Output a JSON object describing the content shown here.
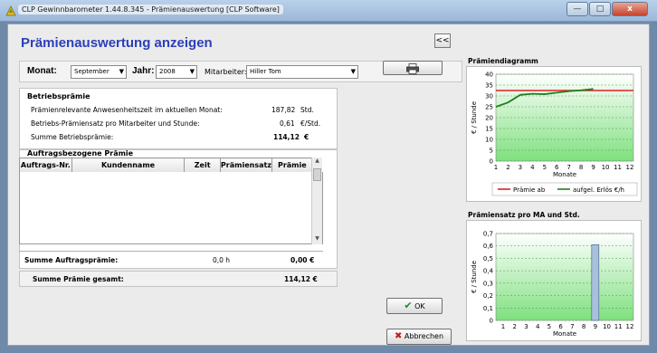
{
  "window": {
    "title": "CLP Gewinnbarometer 1.44.8.345 - Prämienauswertung  [CLP Software]",
    "min_icon": "minimize-icon",
    "max_icon": "maximize-icon",
    "close_label": "x"
  },
  "page": {
    "title": "Prämienauswertung anzeigen",
    "collapse_label": "<<"
  },
  "filters": {
    "monat_label": "Monat:",
    "monat_value": "September",
    "jahr_label": "Jahr:",
    "jahr_value": "2008",
    "mitarbeiter_label": "Mitarbeiter:",
    "mitarbeiter_value": "Hiller Tom"
  },
  "betrieb": {
    "header": "Betriebsprämie",
    "rows": [
      {
        "label": "Prämienrelevante Anwesenheitszeit im aktuellen Monat:",
        "value": "187,82",
        "unit": "Std."
      },
      {
        "label": "Betriebs-Prämiensatz pro Mitarbeiter und Stunde:",
        "value": "0,61",
        "unit": "€/Std."
      },
      {
        "label": "Summe Betriebsprämie:",
        "value": "114,12",
        "unit": "€"
      }
    ]
  },
  "auftrag": {
    "header": "Auftragsbezogene Prämie",
    "columns": [
      "Auftrags-Nr.",
      "Kundenname",
      "Zeit",
      "Prämiensatz",
      "Prämie"
    ],
    "sum_label": "Summe Auftragsprämie:",
    "sum_time": "0,0 h",
    "sum_value": "0,00 €"
  },
  "gesamt": {
    "label": "Summe Prämie gesamt:",
    "value": "114,12 €"
  },
  "buttons": {
    "ok": "OK",
    "cancel": "Abbrechen"
  },
  "colors": {
    "accent_title": "#2b3fb8",
    "chart_bg_top": "#ffffff",
    "chart_bg_bottom": "#7ee07e",
    "line_red": "#e02020",
    "line_green": "#1f7f1f",
    "bar_fill": "#a9c0db"
  },
  "chart_data": [
    {
      "type": "line",
      "title": "Prämiendiagramm",
      "xlabel": "Monate",
      "ylabel": "€ / Stunde",
      "x": [
        1,
        2,
        3,
        4,
        5,
        6,
        7,
        8,
        9,
        10,
        11,
        12
      ],
      "ylim": [
        0,
        40
      ],
      "yticks": [
        0,
        5,
        10,
        15,
        20,
        25,
        30,
        35,
        40
      ],
      "series": [
        {
          "name": "Prämie ab",
          "color": "#e02020",
          "values": [
            32.5,
            32.5,
            32.5,
            32.5,
            32.5,
            32.5,
            32.5,
            32.5,
            32.5,
            32.5,
            32.5,
            32.5
          ]
        },
        {
          "name": "aufgel. Erlös €/h",
          "color": "#1f7f1f",
          "values": [
            25,
            27,
            30.5,
            31,
            30.8,
            31.5,
            32.2,
            32.6,
            33.2,
            null,
            null,
            null
          ]
        }
      ],
      "grid": true,
      "legend": "bottom"
    },
    {
      "type": "bar",
      "title": "Prämiensatz pro MA und Std.",
      "xlabel": "Monate",
      "ylabel": "€ / Stunde",
      "categories": [
        1,
        2,
        3,
        4,
        5,
        6,
        7,
        8,
        9,
        10,
        11,
        12
      ],
      "values": [
        0,
        0,
        0,
        0,
        0,
        0,
        0,
        0,
        0.61,
        0,
        0,
        0
      ],
      "ylim": [
        0,
        0.7
      ],
      "yticks": [
        "0",
        "0,1",
        "0,2",
        "0,3",
        "0,4",
        "0,5",
        "0,6",
        "0,7"
      ],
      "grid": true
    }
  ]
}
